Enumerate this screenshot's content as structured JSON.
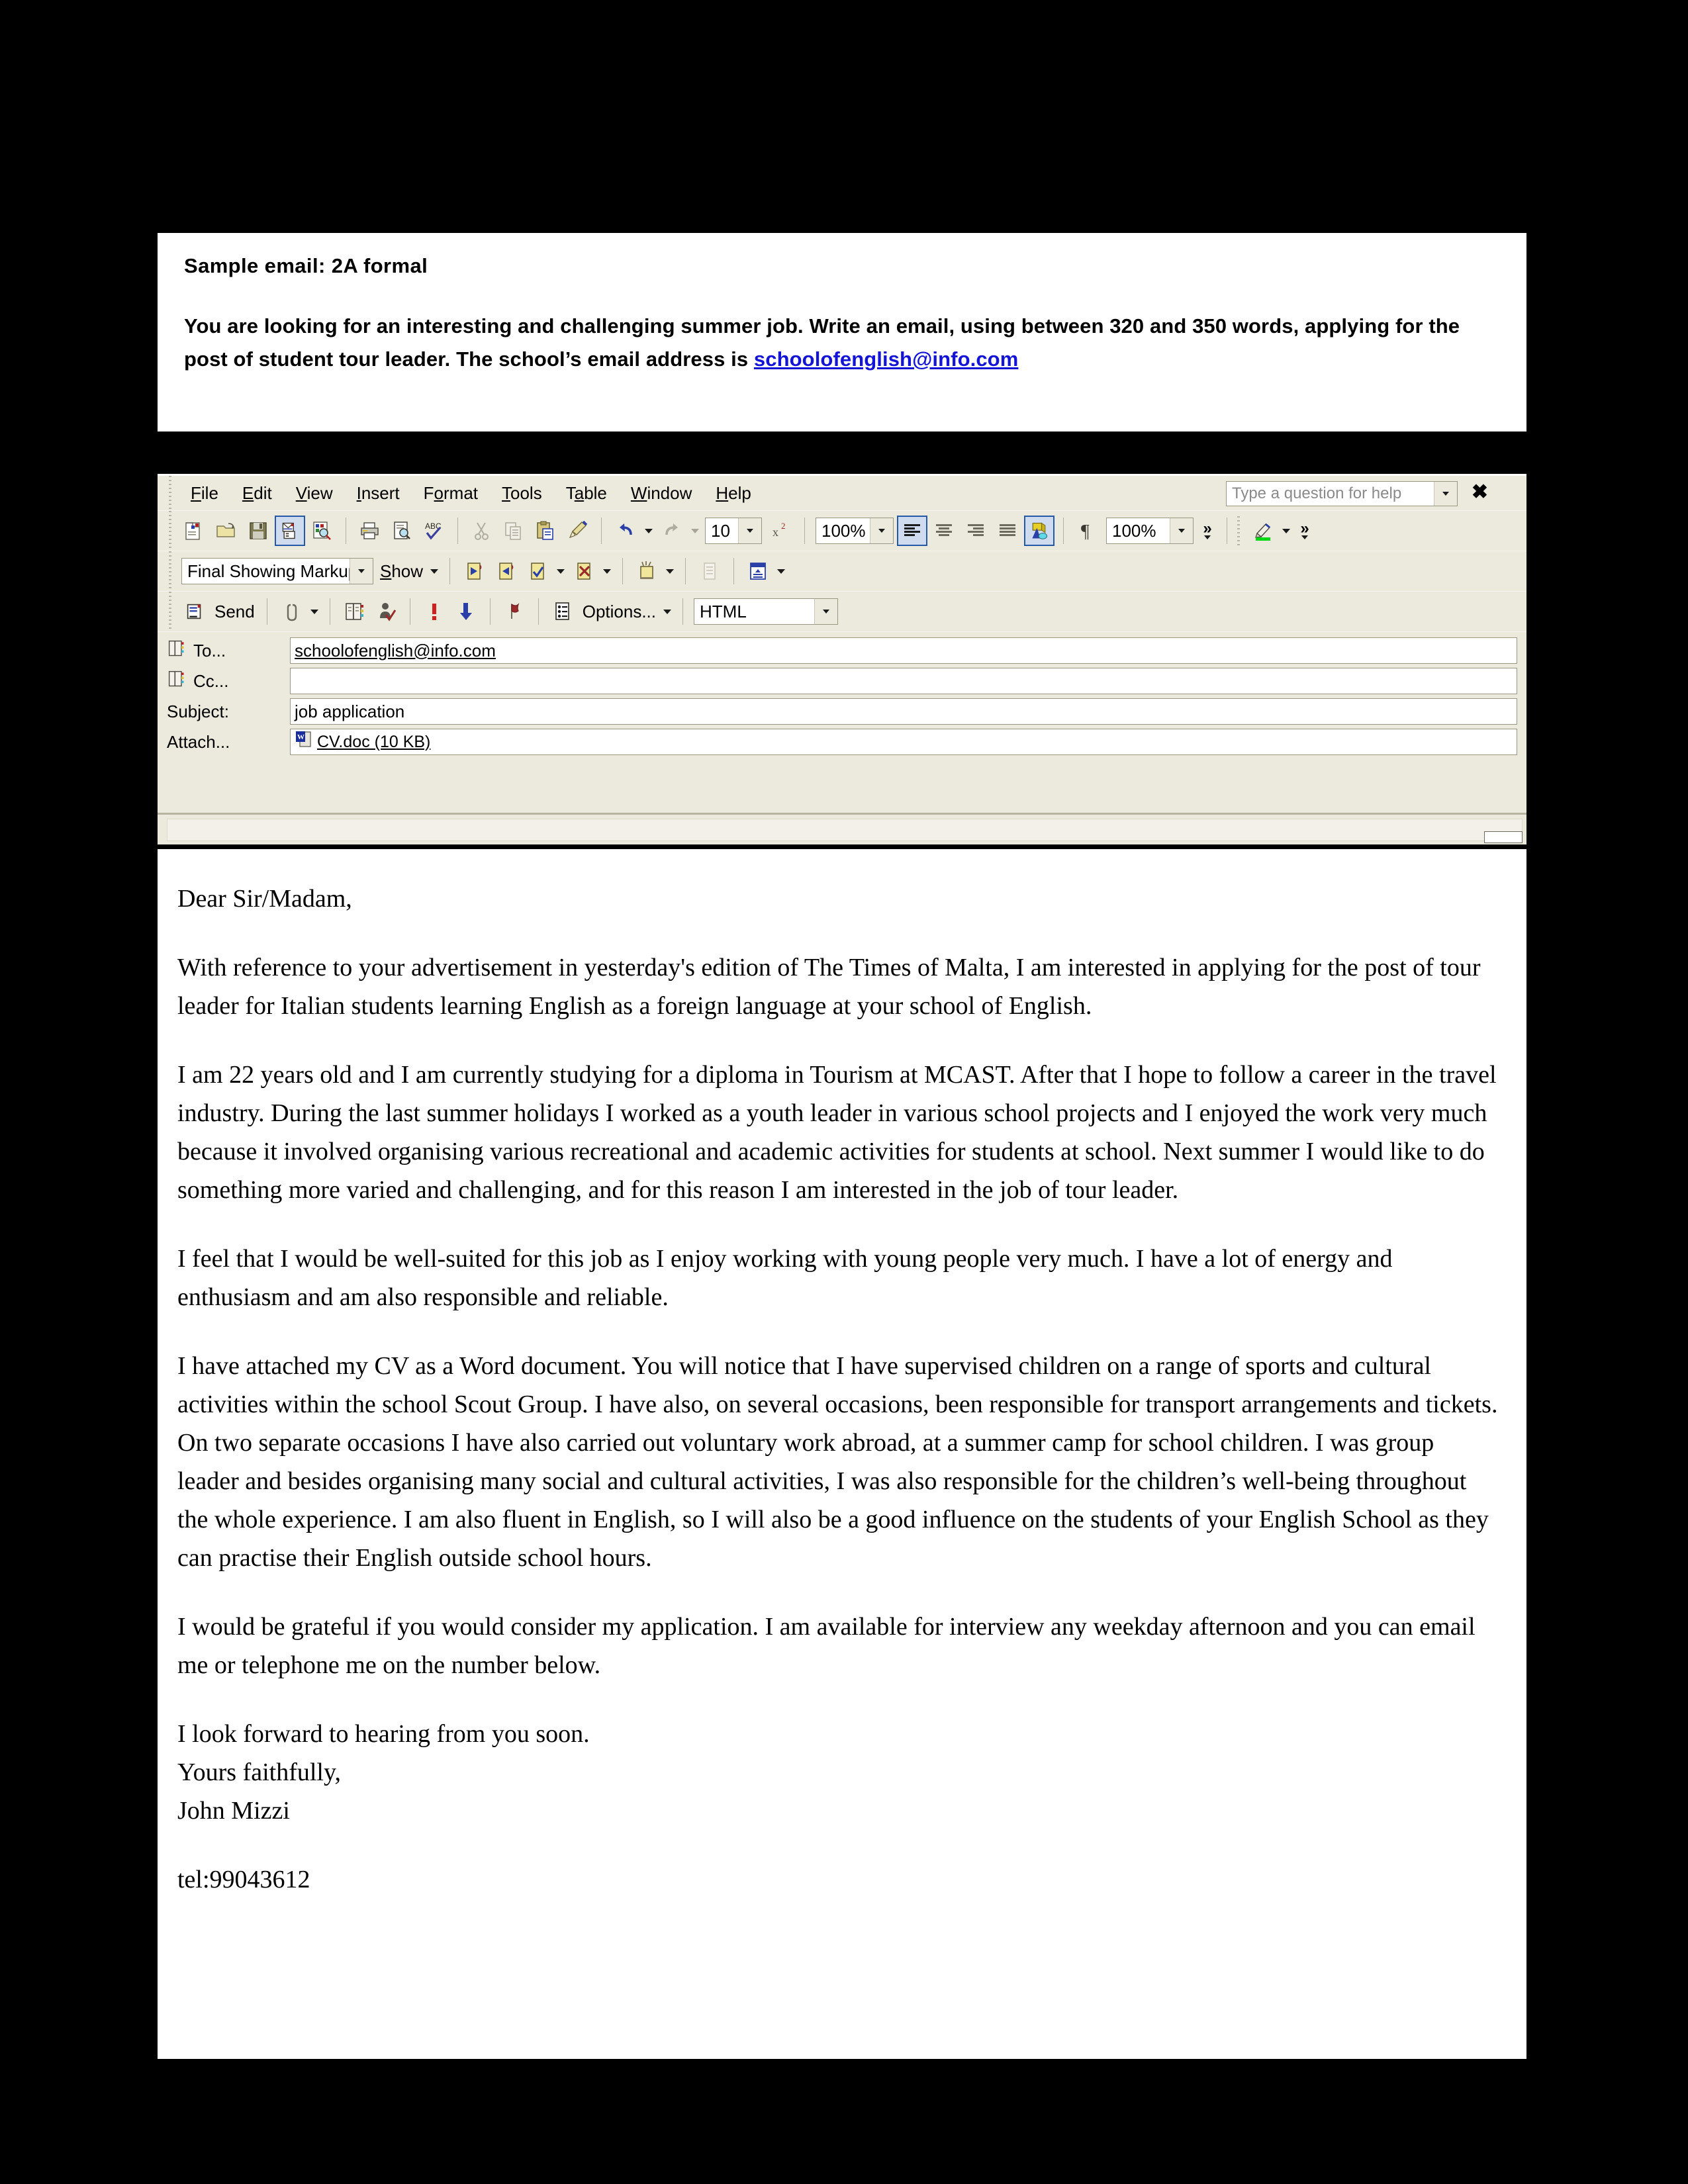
{
  "prompt": {
    "title": "Sample email: 2A formal",
    "instructions_part1": "You are looking for an interesting and challenging summer job.  Write an email, using between 320 and 350 words, applying for the post of student tour leader.  The school’s email address is ",
    "email_link": "schoolofenglish@info.com",
    "link_color": "#1414d6"
  },
  "mail_window": {
    "menu": [
      {
        "label": "File",
        "mnemonic": "F"
      },
      {
        "label": "Edit",
        "mnemonic": "E"
      },
      {
        "label": "View",
        "mnemonic": "V"
      },
      {
        "label": "Insert",
        "mnemonic": "I"
      },
      {
        "label": "Format",
        "mnemonic": "o"
      },
      {
        "label": "Tools",
        "mnemonic": "T"
      },
      {
        "label": "Table",
        "mnemonic": "a"
      },
      {
        "label": "Window",
        "mnemonic": "W"
      },
      {
        "label": "Help",
        "mnemonic": "H"
      }
    ],
    "help_box": {
      "placeholder": "Type a question for help",
      "close_label": "✖"
    },
    "standard_toolbar": {
      "icons": [
        "new-document-icon",
        "open-folder-icon",
        "save-icon",
        "email-icon",
        "search-document-icon",
        "print-icon",
        "print-preview-icon",
        "spelling-check-icon",
        "cut-icon",
        "copy-icon",
        "paste-icon",
        "format-painter-icon",
        "undo-icon",
        "redo-icon"
      ],
      "font_size": "10",
      "superscript_label": "x²",
      "zoom_left": "100%",
      "align_icons": [
        "align-left-icon",
        "align-center-icon",
        "align-right-icon",
        "align-justify-icon"
      ],
      "drawing_icon": "drawing-objects-icon",
      "pilcrow_label": "¶",
      "zoom_right": "100%",
      "overflow_label": "»",
      "highlight_icon": "highlighter-icon",
      "highlight_color": "#00d914"
    },
    "reviewing_toolbar": {
      "display_mode": "Final Showing Markup",
      "show_label": "Show",
      "icons": [
        "previous-change-icon",
        "next-change-icon",
        "accept-change-icon",
        "reject-change-icon",
        "insert-comment-icon",
        "highlight-markup-icon",
        "reviewing-pane-icon"
      ]
    },
    "email_toolbar": {
      "send_label": "Send",
      "attach_icon": "paperclip-icon",
      "address_book_icon": "address-book-icon",
      "check_names_icon": "check-names-icon",
      "high_importance_icon": "high-importance-icon",
      "low_importance_icon": "low-importance-icon",
      "flag_icon": "flag-icon",
      "options_label": "Options...",
      "format": "HTML"
    },
    "fields": {
      "to_label": "To...",
      "to_value": "schoolofenglish@info.com",
      "cc_label": "Cc...",
      "cc_value": "",
      "subject_label": "Subject:",
      "subject_value": "job application",
      "attach_label": "Attach...",
      "attach_value": "CV.doc (10 KB)"
    }
  },
  "letter": {
    "salutation": "Dear Sir/Madam,",
    "p1": "With reference to your advertisement in yesterday's edition of The Times of Malta, I am interested in applying for the post of tour leader for Italian students learning English as a foreign language at your school of English.",
    "p2": "I am 22 years old and I am currently studying for a diploma in Tourism at  MCAST. After that I hope to follow a career in the travel industry. During the last summer holidays I worked as a youth leader in various school projects and I enjoyed the work very much because it involved organising various recreational and academic activities for students at school. Next summer I would like to do something more varied and challenging, and for this reason I am interested in the job of tour leader.",
    "p3": "I feel that I would be well-suited for this job as I enjoy working with young people very much. I have a lot of energy and enthusiasm and am also responsible and reliable.",
    "p4": "I have attached my CV as a Word document. You will notice that I have supervised children on a range of sports and cultural activities within the school Scout Group. I have also, on several occasions, been responsible for transport arrangements and tickets.  On two separate occasions I have also carried out voluntary work abroad, at a summer camp for school children.  I was group leader and besides organising many social and cultural activities, I was also responsible for the children’s well-being throughout the whole experience.  I am also fluent in English, so I will also be a good influence on the students of your English School as they can practise their English outside school hours.",
    "p5": "I would be grateful if you would consider my application. I am available for interview any weekday afternoon and you can email me or telephone me on the number below.",
    "closing_line": "I look forward to hearing from you soon.",
    "sign_off": "Yours faithfully,",
    "sender_name": "John Mizzi",
    "telephone": "tel:99043612"
  }
}
